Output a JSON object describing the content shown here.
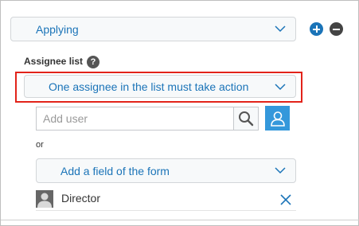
{
  "status": {
    "selected": "Applying",
    "add_tooltip": "Add",
    "remove_tooltip": "Remove"
  },
  "assignee": {
    "section_title": "Assignee list",
    "help_icon": "?",
    "condition_selected": "One assignee in the list must take action",
    "user_input_placeholder": "Add user",
    "or_label": "or",
    "field_selected": "Add a field of the form",
    "entities": [
      {
        "name": "Director",
        "icon": "user-avatar-icon"
      }
    ]
  },
  "colors": {
    "accent": "#1b74b8",
    "highlight": "#e2231a",
    "picker_button": "#3498db"
  }
}
